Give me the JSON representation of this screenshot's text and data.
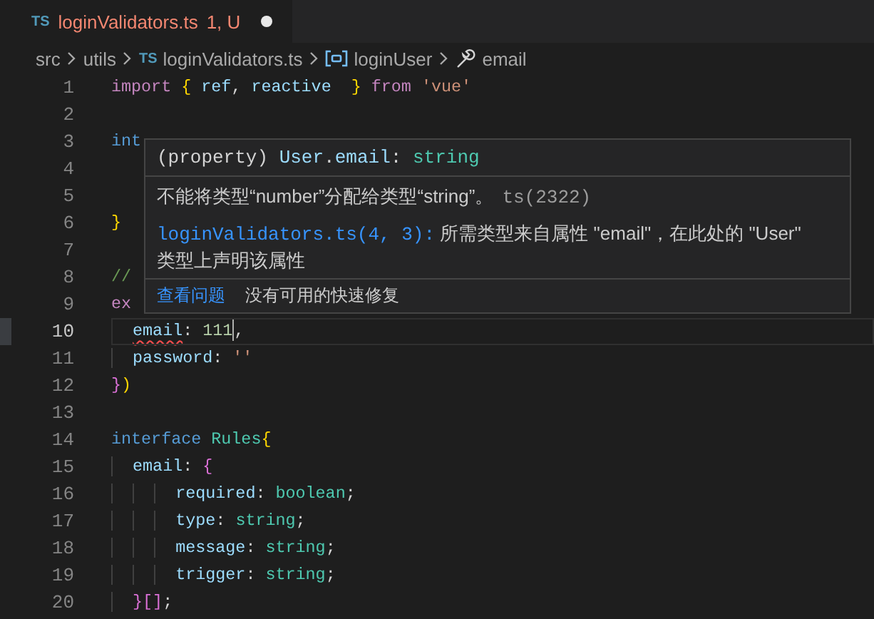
{
  "tab": {
    "icon_text": "TS",
    "filename": "loginValidators.ts",
    "status": "1, U",
    "has_errors": true,
    "modified": true
  },
  "breadcrumbs": [
    {
      "kind": "folder",
      "label": "src"
    },
    {
      "kind": "folder",
      "label": "utils"
    },
    {
      "kind": "file",
      "icon_text": "TS",
      "label": "loginValidators.ts"
    },
    {
      "kind": "variable",
      "label": "loginUser"
    },
    {
      "kind": "property",
      "label": "email"
    }
  ],
  "lines": [
    {
      "number": "1",
      "current": false,
      "tokens": [
        {
          "kind": "control",
          "text": "import "
        },
        {
          "kind": "bracket1",
          "text": "{ "
        },
        {
          "kind": "variable",
          "text": "ref"
        },
        {
          "kind": "plain",
          "text": ", "
        },
        {
          "kind": "variable",
          "text": "reactive  "
        },
        {
          "kind": "bracket1",
          "text": "} "
        },
        {
          "kind": "control",
          "text": "from "
        },
        {
          "kind": "string",
          "text": "'vue'"
        }
      ]
    },
    {
      "number": "2",
      "current": false
    },
    {
      "number": "3",
      "current": false,
      "tokens": [
        {
          "kind": "keyword",
          "text": "int"
        }
      ]
    },
    {
      "number": "4",
      "current": false
    },
    {
      "number": "5",
      "current": false
    },
    {
      "number": "6",
      "current": false,
      "tokens": [
        {
          "kind": "bracket1",
          "text": "}"
        }
      ]
    },
    {
      "number": "7",
      "current": false
    },
    {
      "number": "8",
      "current": false,
      "tokens": [
        {
          "kind": "comment",
          "text": "//"
        }
      ]
    },
    {
      "number": "9",
      "current": false,
      "tokens": [
        {
          "kind": "control",
          "text": "ex"
        }
      ]
    },
    {
      "number": "10",
      "current": true,
      "tokens": [
        {
          "kind": "error",
          "text": "  email"
        },
        {
          "kind": "plain",
          "text": ": "
        },
        {
          "kind": "number",
          "text": "111"
        },
        {
          "kind": "plain",
          "text": ","
        }
      ]
    },
    {
      "number": "11",
      "current": false,
      "tokens": [
        {
          "kind": "variable",
          "text": "  password"
        },
        {
          "kind": "plain",
          "text": ": "
        },
        {
          "kind": "string",
          "text": "''"
        }
      ]
    },
    {
      "number": "12",
      "current": false,
      "tokens": [
        {
          "kind": "bracket2",
          "text": "}"
        },
        {
          "kind": "bracket1",
          "text": ")"
        }
      ]
    },
    {
      "number": "13",
      "current": false
    },
    {
      "number": "14",
      "current": false,
      "tokens": [
        {
          "kind": "keyword",
          "text": "interface "
        },
        {
          "kind": "type",
          "text": "Rules"
        },
        {
          "kind": "bracket1",
          "text": "{"
        }
      ]
    },
    {
      "number": "15",
      "current": false,
      "tokens": [
        {
          "kind": "variable",
          "text": "  email"
        },
        {
          "kind": "plain",
          "text": ": "
        },
        {
          "kind": "bracket2",
          "text": "{"
        }
      ]
    },
    {
      "number": "16",
      "current": false,
      "tokens": [
        {
          "kind": "variable",
          "text": "      required"
        },
        {
          "kind": "plain",
          "text": ": "
        },
        {
          "kind": "type",
          "text": "boolean"
        },
        {
          "kind": "plain",
          "text": ";"
        }
      ]
    },
    {
      "number": "17",
      "current": false,
      "tokens": [
        {
          "kind": "variable",
          "text": "      type"
        },
        {
          "kind": "plain",
          "text": ": "
        },
        {
          "kind": "type",
          "text": "string"
        },
        {
          "kind": "plain",
          "text": ";"
        }
      ]
    },
    {
      "number": "18",
      "current": false,
      "tokens": [
        {
          "kind": "variable",
          "text": "      message"
        },
        {
          "kind": "plain",
          "text": ": "
        },
        {
          "kind": "type",
          "text": "string"
        },
        {
          "kind": "plain",
          "text": ";"
        }
      ]
    },
    {
      "number": "19",
      "current": false,
      "tokens": [
        {
          "kind": "variable",
          "text": "      trigger"
        },
        {
          "kind": "plain",
          "text": ": "
        },
        {
          "kind": "type",
          "text": "string"
        },
        {
          "kind": "plain",
          "text": ";"
        }
      ]
    },
    {
      "number": "20",
      "current": false,
      "tokens": [
        {
          "kind": "bracket2",
          "text": "  }[]"
        },
        {
          "kind": "plain",
          "text": ";"
        }
      ]
    }
  ],
  "hover": {
    "signature": [
      {
        "kind": "plain",
        "text": "(property) "
      },
      {
        "kind": "variable",
        "text": "User"
      },
      {
        "kind": "plain",
        "text": "."
      },
      {
        "kind": "variable",
        "text": "email"
      },
      {
        "kind": "plain",
        "text": ": "
      },
      {
        "kind": "type",
        "text": "string"
      }
    ],
    "message": "不能将类型“number”分配给类型“string”。",
    "error_code": "ts(2322)",
    "related_link": "loginValidators.ts(4, 3):",
    "related_text": "所需类型来自属性 \"email\"，在此处的 \"User\" 类型上声明该属性",
    "actions": [
      {
        "kind": "link",
        "label": "查看问题"
      },
      {
        "kind": "text",
        "label": "没有可用的快速修复"
      }
    ]
  }
}
